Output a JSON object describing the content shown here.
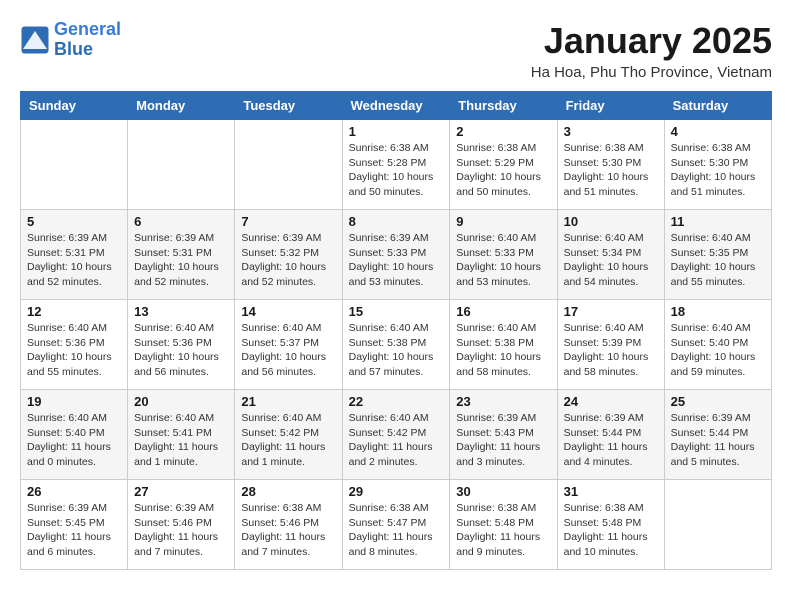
{
  "header": {
    "logo_line1": "General",
    "logo_line2": "Blue",
    "title": "January 2025",
    "subtitle": "Ha Hoa, Phu Tho Province, Vietnam"
  },
  "weekdays": [
    "Sunday",
    "Monday",
    "Tuesday",
    "Wednesday",
    "Thursday",
    "Friday",
    "Saturday"
  ],
  "weeks": [
    [
      {
        "day": "",
        "info": ""
      },
      {
        "day": "",
        "info": ""
      },
      {
        "day": "",
        "info": ""
      },
      {
        "day": "1",
        "info": "Sunrise: 6:38 AM\nSunset: 5:28 PM\nDaylight: 10 hours\nand 50 minutes."
      },
      {
        "day": "2",
        "info": "Sunrise: 6:38 AM\nSunset: 5:29 PM\nDaylight: 10 hours\nand 50 minutes."
      },
      {
        "day": "3",
        "info": "Sunrise: 6:38 AM\nSunset: 5:30 PM\nDaylight: 10 hours\nand 51 minutes."
      },
      {
        "day": "4",
        "info": "Sunrise: 6:38 AM\nSunset: 5:30 PM\nDaylight: 10 hours\nand 51 minutes."
      }
    ],
    [
      {
        "day": "5",
        "info": "Sunrise: 6:39 AM\nSunset: 5:31 PM\nDaylight: 10 hours\nand 52 minutes."
      },
      {
        "day": "6",
        "info": "Sunrise: 6:39 AM\nSunset: 5:31 PM\nDaylight: 10 hours\nand 52 minutes."
      },
      {
        "day": "7",
        "info": "Sunrise: 6:39 AM\nSunset: 5:32 PM\nDaylight: 10 hours\nand 52 minutes."
      },
      {
        "day": "8",
        "info": "Sunrise: 6:39 AM\nSunset: 5:33 PM\nDaylight: 10 hours\nand 53 minutes."
      },
      {
        "day": "9",
        "info": "Sunrise: 6:40 AM\nSunset: 5:33 PM\nDaylight: 10 hours\nand 53 minutes."
      },
      {
        "day": "10",
        "info": "Sunrise: 6:40 AM\nSunset: 5:34 PM\nDaylight: 10 hours\nand 54 minutes."
      },
      {
        "day": "11",
        "info": "Sunrise: 6:40 AM\nSunset: 5:35 PM\nDaylight: 10 hours\nand 55 minutes."
      }
    ],
    [
      {
        "day": "12",
        "info": "Sunrise: 6:40 AM\nSunset: 5:36 PM\nDaylight: 10 hours\nand 55 minutes."
      },
      {
        "day": "13",
        "info": "Sunrise: 6:40 AM\nSunset: 5:36 PM\nDaylight: 10 hours\nand 56 minutes."
      },
      {
        "day": "14",
        "info": "Sunrise: 6:40 AM\nSunset: 5:37 PM\nDaylight: 10 hours\nand 56 minutes."
      },
      {
        "day": "15",
        "info": "Sunrise: 6:40 AM\nSunset: 5:38 PM\nDaylight: 10 hours\nand 57 minutes."
      },
      {
        "day": "16",
        "info": "Sunrise: 6:40 AM\nSunset: 5:38 PM\nDaylight: 10 hours\nand 58 minutes."
      },
      {
        "day": "17",
        "info": "Sunrise: 6:40 AM\nSunset: 5:39 PM\nDaylight: 10 hours\nand 58 minutes."
      },
      {
        "day": "18",
        "info": "Sunrise: 6:40 AM\nSunset: 5:40 PM\nDaylight: 10 hours\nand 59 minutes."
      }
    ],
    [
      {
        "day": "19",
        "info": "Sunrise: 6:40 AM\nSunset: 5:40 PM\nDaylight: 11 hours\nand 0 minutes."
      },
      {
        "day": "20",
        "info": "Sunrise: 6:40 AM\nSunset: 5:41 PM\nDaylight: 11 hours\nand 1 minute."
      },
      {
        "day": "21",
        "info": "Sunrise: 6:40 AM\nSunset: 5:42 PM\nDaylight: 11 hours\nand 1 minute."
      },
      {
        "day": "22",
        "info": "Sunrise: 6:40 AM\nSunset: 5:42 PM\nDaylight: 11 hours\nand 2 minutes."
      },
      {
        "day": "23",
        "info": "Sunrise: 6:39 AM\nSunset: 5:43 PM\nDaylight: 11 hours\nand 3 minutes."
      },
      {
        "day": "24",
        "info": "Sunrise: 6:39 AM\nSunset: 5:44 PM\nDaylight: 11 hours\nand 4 minutes."
      },
      {
        "day": "25",
        "info": "Sunrise: 6:39 AM\nSunset: 5:44 PM\nDaylight: 11 hours\nand 5 minutes."
      }
    ],
    [
      {
        "day": "26",
        "info": "Sunrise: 6:39 AM\nSunset: 5:45 PM\nDaylight: 11 hours\nand 6 minutes."
      },
      {
        "day": "27",
        "info": "Sunrise: 6:39 AM\nSunset: 5:46 PM\nDaylight: 11 hours\nand 7 minutes."
      },
      {
        "day": "28",
        "info": "Sunrise: 6:38 AM\nSunset: 5:46 PM\nDaylight: 11 hours\nand 7 minutes."
      },
      {
        "day": "29",
        "info": "Sunrise: 6:38 AM\nSunset: 5:47 PM\nDaylight: 11 hours\nand 8 minutes."
      },
      {
        "day": "30",
        "info": "Sunrise: 6:38 AM\nSunset: 5:48 PM\nDaylight: 11 hours\nand 9 minutes."
      },
      {
        "day": "31",
        "info": "Sunrise: 6:38 AM\nSunset: 5:48 PM\nDaylight: 11 hours\nand 10 minutes."
      },
      {
        "day": "",
        "info": ""
      }
    ]
  ]
}
